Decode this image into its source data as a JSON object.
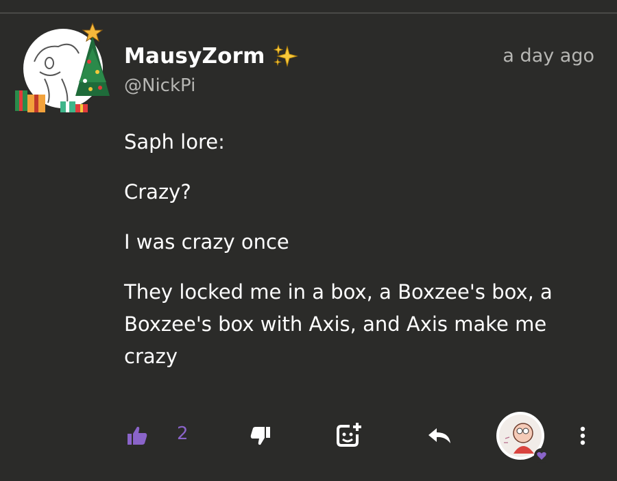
{
  "post": {
    "username": "MausyZorm",
    "handle": "@NickPi",
    "timestamp": "a day ago",
    "paragraphs": [
      "Saph lore:",
      "Crazy?",
      "I was crazy once",
      "They locked me in a box, a Boxzee's box, a Boxzee's box with Axis, and Axis make me crazy"
    ]
  },
  "actions": {
    "like_count": "2",
    "icons": [
      "thumbs-up-icon",
      "thumbs-down-icon",
      "add-reaction-icon",
      "reply-icon",
      "reactor-avatar",
      "more-options-icon"
    ]
  },
  "colors": {
    "background": "#2b2b29",
    "accent": "#8a64c9",
    "muted": "#b7b7b4"
  }
}
